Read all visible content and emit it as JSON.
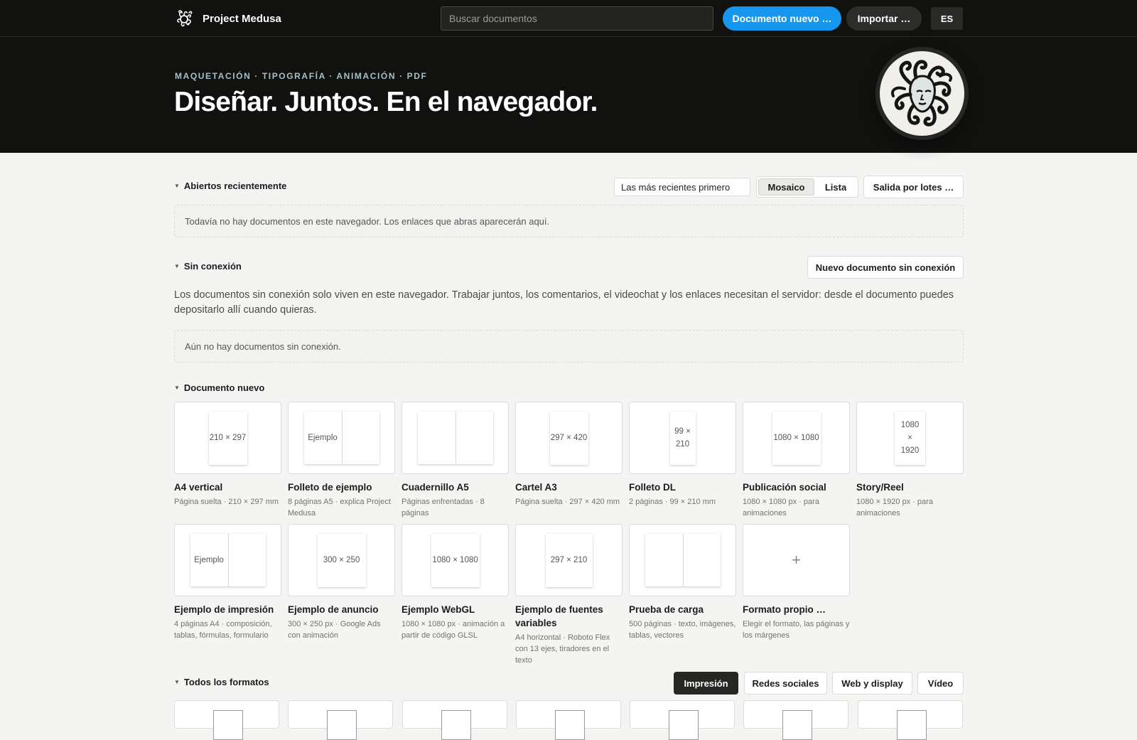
{
  "app": {
    "name": "Project Medusa"
  },
  "header": {
    "search_placeholder": "Buscar documentos",
    "new_document_label": "Documento nuevo …",
    "import_label": "Importar …",
    "language_label": "ES"
  },
  "hero": {
    "kicker": "MAQUETACIÓN · TIPOGRAFÍA · ANIMACIÓN · PDF",
    "title": "Diseñar. Juntos. En el navegador."
  },
  "recent": {
    "title": "Abiertos recientemente",
    "sort_value": "Las más recientes primero",
    "view_mosaic": "Mosaico",
    "view_list": "Lista",
    "batch_label": "Salida por lotes …",
    "empty_text": "Todavía no hay documentos en este navegador. Los enlaces que abras aparecerán aquí."
  },
  "offline": {
    "title": "Sin conexión",
    "new_label": "Nuevo documento sin conexión",
    "description": "Los documentos sin conexión solo viven en este navegador. Trabajar juntos, los comentarios, el videochat y los enlaces necesitan el servidor: desde el documento puedes depositarlo allí cuando quieras.",
    "empty_text": "Aún no hay documentos sin conexión."
  },
  "new_document": {
    "title": "Documento nuevo",
    "templates": [
      {
        "name": "A4 vertical",
        "sub": "Página suelta · 210 × 297 mm",
        "thumb": "210 × 297"
      },
      {
        "name": "Folleto de ejemplo",
        "sub": "8 páginas A5 · explica Project Medusa",
        "thumb": "Ejemplo"
      },
      {
        "name": "Cuadernillo A5",
        "sub": "Páginas enfrentadas · 8 páginas",
        "thumb": ""
      },
      {
        "name": "Cartel A3",
        "sub": "Página suelta · 297 × 420 mm",
        "thumb": "297 × 420"
      },
      {
        "name": "Folleto DL",
        "sub": "2 páginas · 99 × 210 mm",
        "thumb": "99 × 210"
      },
      {
        "name": "Publicación social",
        "sub": "1080 × 1080 px · para animaciones",
        "thumb": "1080 × 1080"
      },
      {
        "name": "Story/Reel",
        "sub": "1080 × 1920 px · para animaciones",
        "thumb": "1080 × 1920"
      },
      {
        "name": "Ejemplo de impresión",
        "sub": "4 páginas A4 · composición, tablas, fórmulas, formulario",
        "thumb": "Ejemplo"
      },
      {
        "name": "Ejemplo de anuncio",
        "sub": "300 × 250 px · Google Ads con animación",
        "thumb": "300 × 250"
      },
      {
        "name": "Ejemplo WebGL",
        "sub": "1080 × 1080 px · animación a partir de código GLSL",
        "thumb": "1080 × 1080"
      },
      {
        "name": "Ejemplo de fuentes variables",
        "sub": "A4 horizontal · Roboto Flex con 13 ejes, tiradores en el texto",
        "thumb": "297 × 210"
      },
      {
        "name": "Prueba de carga",
        "sub": "500 páginas · texto, imágenes, tablas, vectores",
        "thumb": ""
      },
      {
        "name": "Formato propio …",
        "sub": "Elegir el formato, las páginas y los márgenes",
        "thumb": "+"
      }
    ]
  },
  "all_formats": {
    "title": "Todos los formatos",
    "tabs": [
      "Impresión",
      "Redes sociales",
      "Web y display",
      "Vídeo"
    ]
  }
}
